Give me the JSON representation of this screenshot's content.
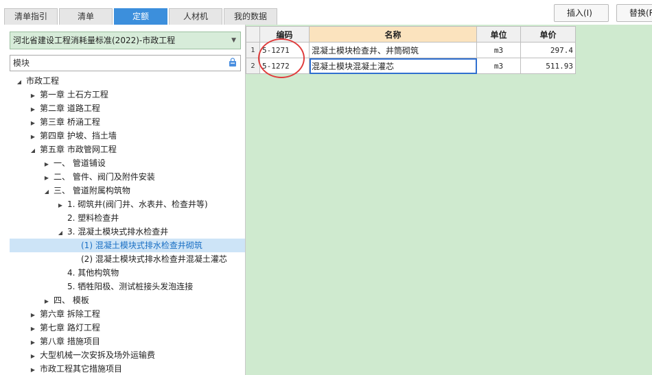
{
  "tabs": [
    {
      "label": "清单指引",
      "active": false
    },
    {
      "label": "清单",
      "active": false
    },
    {
      "label": "定额",
      "active": true
    },
    {
      "label": "人材机",
      "active": false
    },
    {
      "label": "我的数据",
      "active": false
    }
  ],
  "toolbar": {
    "insert_label": "插入(I)",
    "replace_label": "替换(R"
  },
  "library": {
    "selected": "河北省建设工程消耗量标准(2022)-市政工程"
  },
  "search": {
    "value": "模块"
  },
  "tree": [
    {
      "label": "市政工程",
      "level": 0,
      "state": "expanded"
    },
    {
      "label": "第一章 土石方工程",
      "level": 1,
      "state": "collapsed"
    },
    {
      "label": "第二章 道路工程",
      "level": 1,
      "state": "collapsed"
    },
    {
      "label": "第三章 桥涵工程",
      "level": 1,
      "state": "collapsed"
    },
    {
      "label": "第四章 护坡、挡土墙",
      "level": 1,
      "state": "collapsed"
    },
    {
      "label": "第五章 市政管网工程",
      "level": 1,
      "state": "expanded"
    },
    {
      "label": "一、 管道铺设",
      "level": 2,
      "state": "collapsed"
    },
    {
      "label": "二、 管件、阀门及附件安装",
      "level": 2,
      "state": "collapsed"
    },
    {
      "label": "三、 管道附属构筑物",
      "level": 2,
      "state": "expanded"
    },
    {
      "label": "1. 砌筑井(阀门井、水表井、检查井等)",
      "level": 3,
      "state": "collapsed"
    },
    {
      "label": "2. 塑料检查井",
      "level": 3,
      "state": "leaf"
    },
    {
      "label": "3. 混凝土模块式排水检查井",
      "level": 3,
      "state": "expanded"
    },
    {
      "label": "(1) 混凝土模块式排水检查井砌筑",
      "level": 4,
      "state": "leaf",
      "selected": true
    },
    {
      "label": "(2) 混凝土模块式排水检查井混凝土灌芯",
      "level": 4,
      "state": "leaf"
    },
    {
      "label": "4. 其他构筑物",
      "level": 3,
      "state": "leaf"
    },
    {
      "label": "5. 牺牲阳极、测试桩接头发泡连接",
      "level": 3,
      "state": "leaf"
    },
    {
      "label": "四、 模板",
      "level": 2,
      "state": "collapsed"
    },
    {
      "label": "第六章 拆除工程",
      "level": 1,
      "state": "collapsed"
    },
    {
      "label": "第七章 路灯工程",
      "level": 1,
      "state": "collapsed"
    },
    {
      "label": "第八章 措施项目",
      "level": 1,
      "state": "collapsed"
    },
    {
      "label": "大型机械一次安拆及场外运输费",
      "level": 1,
      "state": "collapsed"
    },
    {
      "label": "市政工程其它措施项目",
      "level": 1,
      "state": "collapsed"
    }
  ],
  "grid": {
    "columns": [
      "编码",
      "名称",
      "单位",
      "单价"
    ],
    "rows": [
      {
        "num": "1",
        "code": "5-1271",
        "name": "混凝土模块检查井、井筒砌筑",
        "unit": "m3",
        "price": "297.4"
      },
      {
        "num": "2",
        "code": "5-1272",
        "name": "混凝土模块混凝土灌芯",
        "unit": "m3",
        "price": "511.93"
      }
    ]
  },
  "colors": {
    "active_tab": "#3c8fdc",
    "library_bg": "#d7ecd9",
    "grid_bg": "#cfeacf",
    "name_header": "#fbe3be",
    "selection": "#cde4f7",
    "annotation": "#e03c3c"
  },
  "icons": {
    "tree_expanded": "expanded-triangle-icon",
    "tree_collapsed": "collapsed-triangle-icon",
    "dropdown": "chevron-down-icon",
    "search_action": "bag-icon"
  }
}
